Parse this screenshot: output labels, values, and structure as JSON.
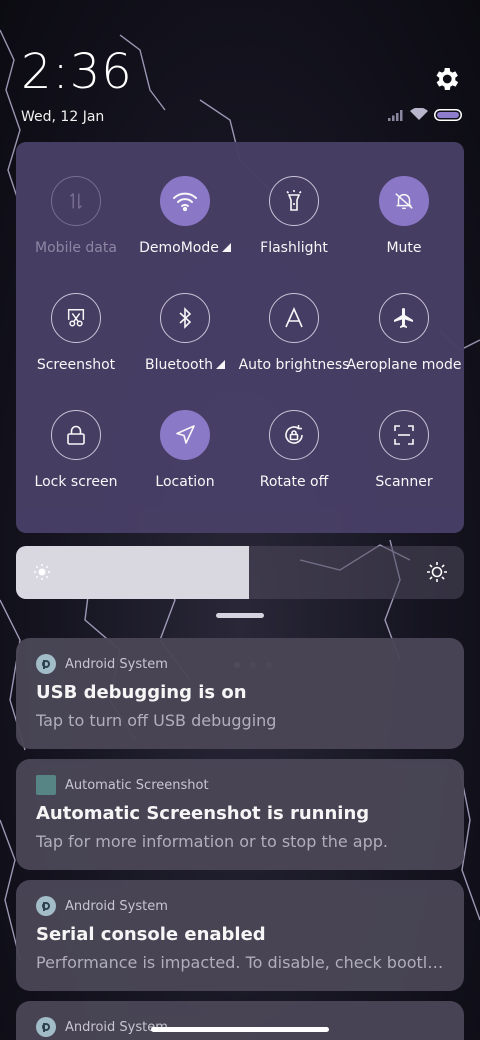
{
  "status": {
    "time": "2:36",
    "date": "Wed, 12 Jan"
  },
  "quick_settings": {
    "tiles": [
      {
        "label": "Mobile data",
        "icon": "mobile-data-icon",
        "state": "disabled"
      },
      {
        "label": "DemoMode",
        "icon": "wifi-icon",
        "state": "active",
        "expand": true
      },
      {
        "label": "Flashlight",
        "icon": "flashlight-icon",
        "state": "off"
      },
      {
        "label": "Mute",
        "icon": "mute-bell-icon",
        "state": "active"
      },
      {
        "label": "Screenshot",
        "icon": "screenshot-icon",
        "state": "off"
      },
      {
        "label": "Bluetooth",
        "icon": "bluetooth-icon",
        "state": "off",
        "expand": true
      },
      {
        "label": "Auto brightness",
        "icon": "auto-brightness-icon",
        "state": "off"
      },
      {
        "label": "Aeroplane mode",
        "icon": "airplane-icon",
        "state": "off"
      },
      {
        "label": "Lock screen",
        "icon": "lock-icon",
        "state": "off"
      },
      {
        "label": "Location",
        "icon": "location-icon",
        "state": "active"
      },
      {
        "label": "Rotate off",
        "icon": "rotate-lock-icon",
        "state": "off"
      },
      {
        "label": "Scanner",
        "icon": "scanner-icon",
        "state": "off"
      }
    ],
    "page_count": 3,
    "current_page": 1
  },
  "brightness": {
    "level": 0.52
  },
  "notifications": [
    {
      "app": "Android System",
      "title": "USB debugging is on",
      "text": "Tap to turn off USB debugging"
    },
    {
      "app": "Automatic Screenshot",
      "title": "Automatic Screenshot is running",
      "text": "Tap for more information or to stop the app."
    },
    {
      "app": "Android System",
      "title": "Serial console enabled",
      "text": "Performance is impacted. To disable, check bootl…"
    },
    {
      "app": "Android System",
      "title": "",
      "text": ""
    }
  ],
  "colors": {
    "panel": "#483f66",
    "active_tile": "#8e7ccc",
    "notification_bg": "#4a4656"
  }
}
